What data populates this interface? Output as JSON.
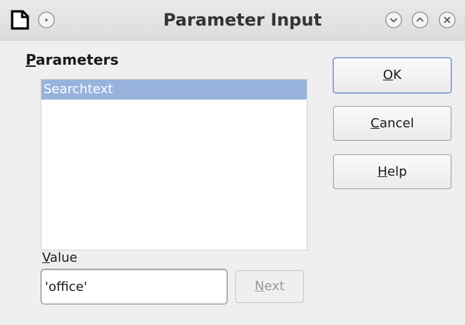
{
  "window": {
    "title": "Parameter Input"
  },
  "titlebar_icons": {
    "app": "document-icon",
    "menu": "window-menu-icon",
    "minimize": "minimize-icon",
    "maximize": "maximize-icon",
    "close": "close-icon"
  },
  "parameters": {
    "label_mnemonic": "P",
    "label_rest": "arameters",
    "items": [
      "Searchtext"
    ],
    "selected_index": 0
  },
  "value": {
    "label_mnemonic": "V",
    "label_rest": "alue",
    "input_value": "'office'"
  },
  "buttons": {
    "next": {
      "mnemonic": "N",
      "rest": "ext",
      "enabled": false
    },
    "ok": {
      "mnemonic": "O",
      "rest": "K"
    },
    "cancel": {
      "mnemonic": "C",
      "rest": "ancel"
    },
    "help": {
      "mnemonic": "H",
      "rest": "elp"
    }
  },
  "colors": {
    "selection": "#97b3dc",
    "background": "#efefef",
    "default_button_border": "#6f8fc1"
  }
}
